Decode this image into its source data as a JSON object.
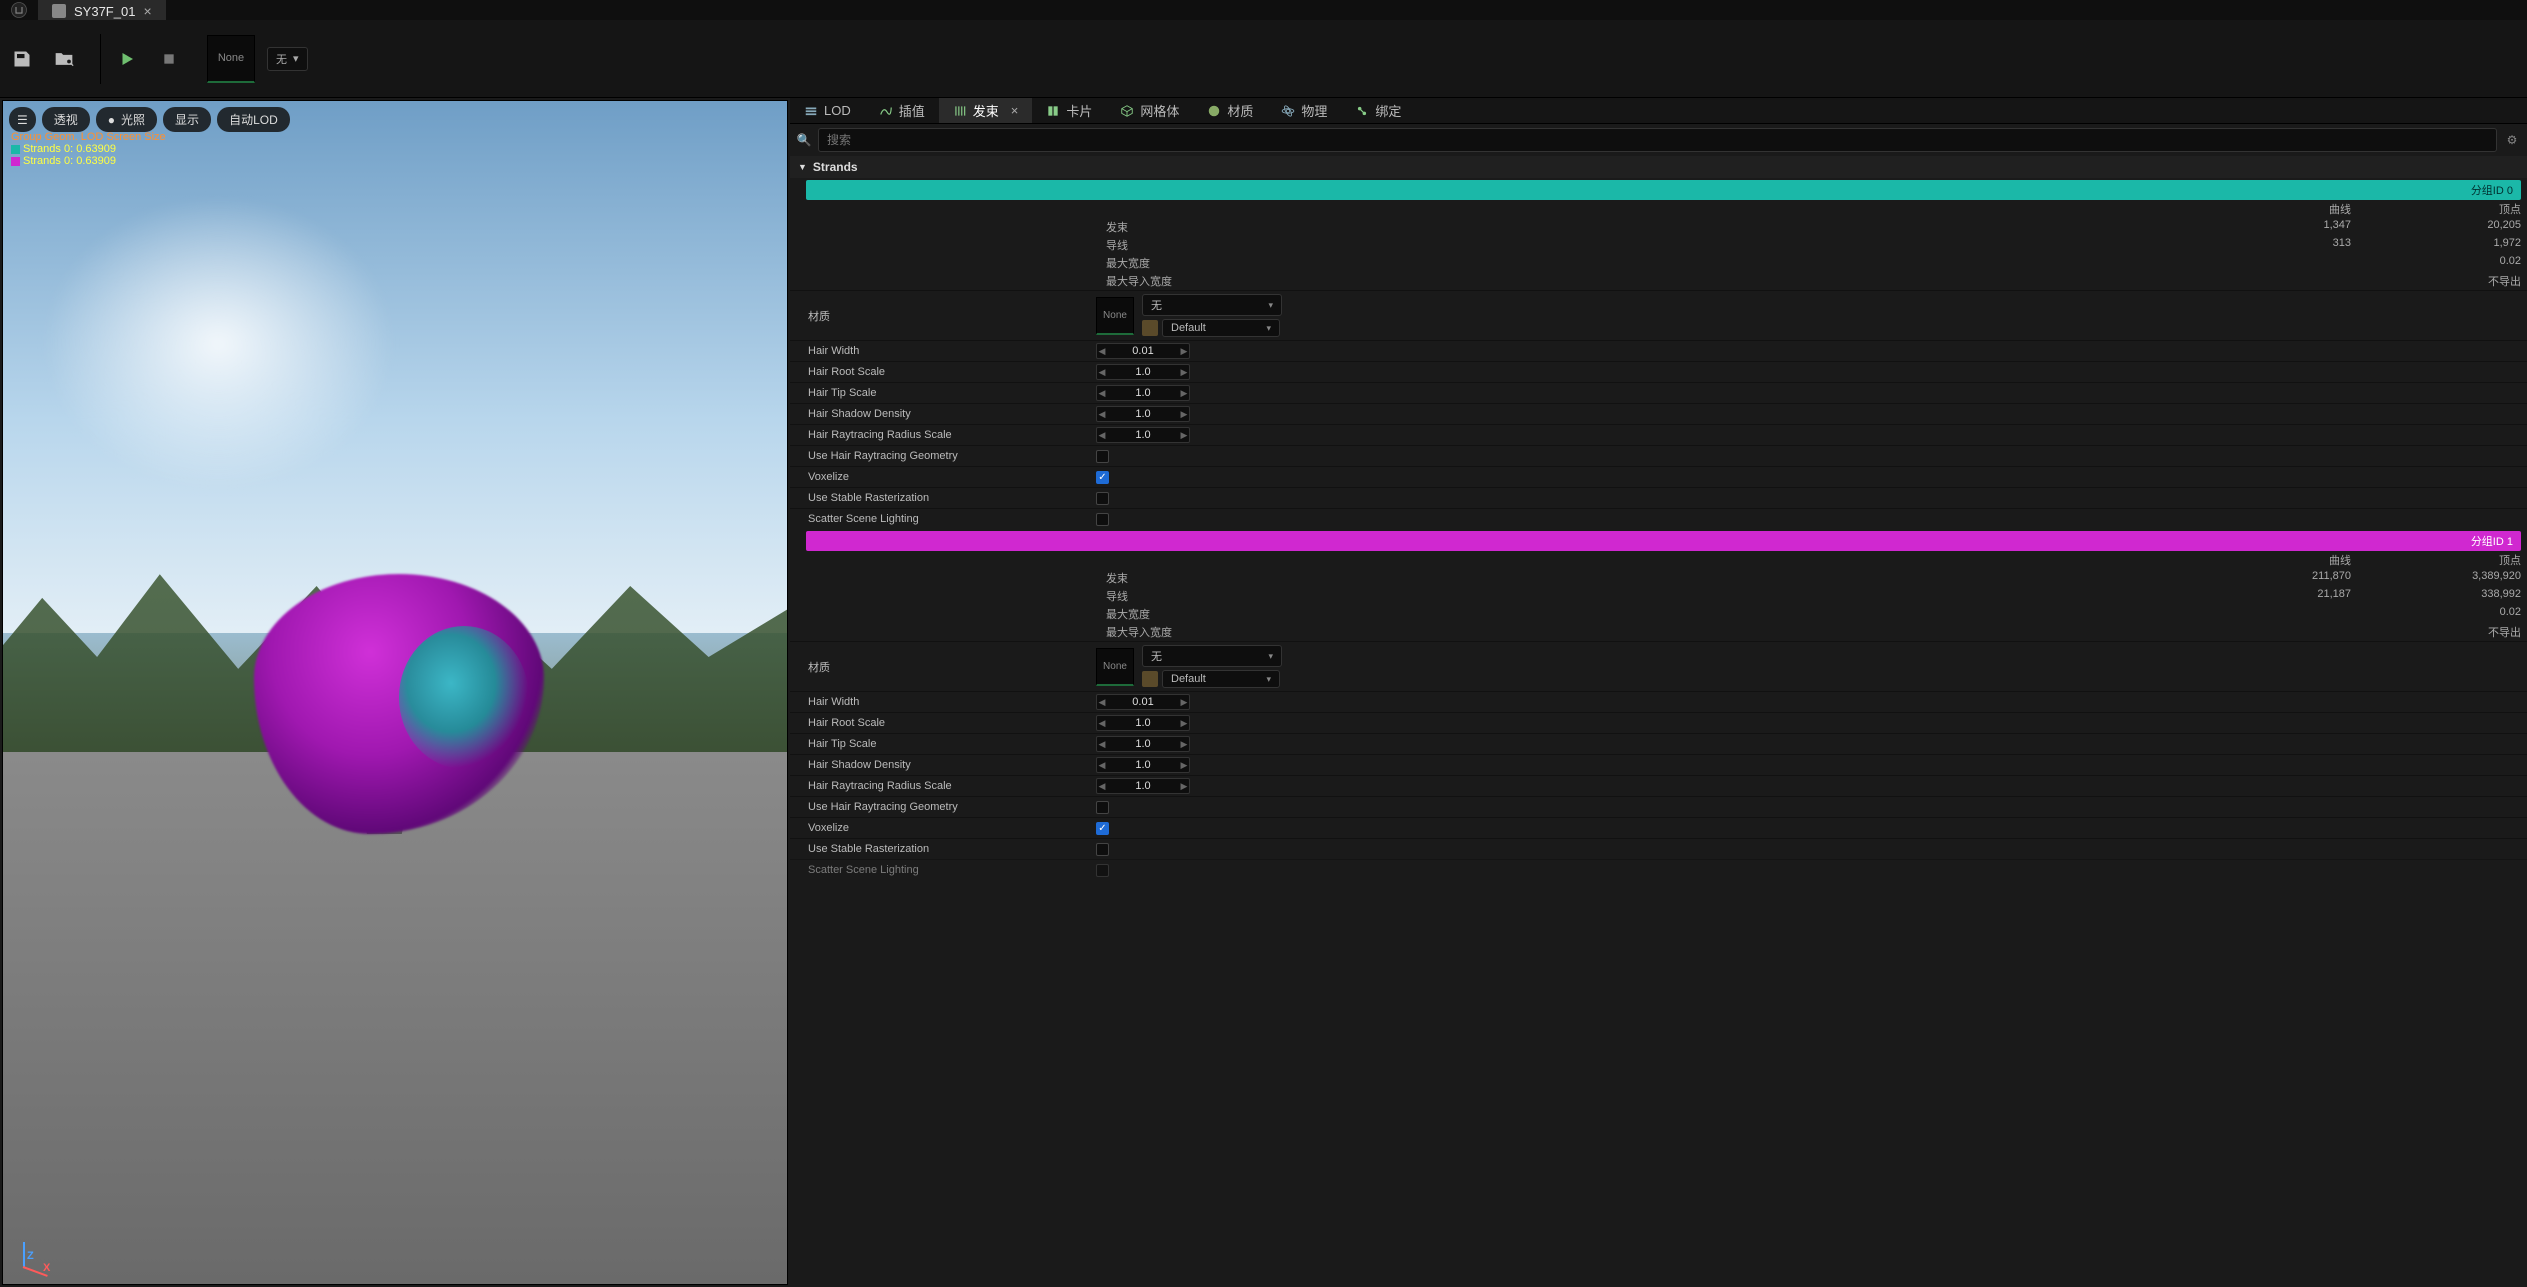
{
  "tab": {
    "title": "SY37F_01"
  },
  "toolbar": {
    "thumb_label": "None",
    "wu_label": "无"
  },
  "viewport": {
    "pills": {
      "perspective": "透视",
      "lighting": "光照",
      "display": "显示",
      "autolod": "自动LOD"
    },
    "stats": {
      "line1": "Group Geom. LOD  Screen Size",
      "line2a": "Strands 0:",
      "line2b": "0.63909",
      "line3a": "Strands 0:",
      "line3b": "0.63909"
    },
    "axis": {
      "z": "Z",
      "x": "X"
    }
  },
  "details_tabs": {
    "lod": "LOD",
    "interp": "插值",
    "strands": "发束",
    "cards": "卡片",
    "meshes": "网格体",
    "material": "材质",
    "physics": "物理",
    "binding": "绑定"
  },
  "search": {
    "placeholder": "搜索"
  },
  "category": {
    "strands": "Strands"
  },
  "group0": {
    "bar": "分组ID 0",
    "col_curves": "曲线",
    "col_verts": "顶点",
    "row_strands_l": "发束",
    "row_strands_c": "1,347",
    "row_strands_v": "20,205",
    "row_guides_l": "导线",
    "row_guides_c": "313",
    "row_guides_v": "1,972",
    "row_maxw_l": "最大宽度",
    "row_maxw_v": "0.02",
    "row_maximp_l": "最大导入宽度",
    "row_maximp_v": "不导出",
    "material_label": "材质",
    "mat_none": "None",
    "mat_dd1": "无",
    "mat_dd2": "Default"
  },
  "group1": {
    "bar": "分组ID 1",
    "col_curves": "曲线",
    "col_verts": "顶点",
    "row_strands_l": "发束",
    "row_strands_c": "211,870",
    "row_strands_v": "3,389,920",
    "row_guides_l": "导线",
    "row_guides_c": "21,187",
    "row_guides_v": "338,992",
    "row_maxw_l": "最大宽度",
    "row_maxw_v": "0.02",
    "row_maximp_l": "最大导入宽度",
    "row_maximp_v": "不导出",
    "material_label": "材质",
    "mat_none": "None",
    "mat_dd1": "无",
    "mat_dd2": "Default"
  },
  "props": {
    "hair_width": "Hair Width",
    "hair_root_scale": "Hair Root Scale",
    "hair_tip_scale": "Hair Tip Scale",
    "hair_shadow_density": "Hair Shadow Density",
    "hair_rt_radius_scale": "Hair Raytracing Radius Scale",
    "use_hair_rt_geom": "Use Hair Raytracing Geometry",
    "voxelize": "Voxelize",
    "use_stable_raster": "Use Stable Rasterization",
    "scatter_scene_lighting": "Scatter Scene Lighting"
  },
  "vals0": {
    "hair_width": "0.01",
    "hair_root_scale": "1.0",
    "hair_tip_scale": "1.0",
    "hair_shadow_density": "1.0",
    "hair_rt_radius_scale": "1.0"
  },
  "vals1": {
    "hair_width": "0.01",
    "hair_root_scale": "1.0",
    "hair_tip_scale": "1.0",
    "hair_shadow_density": "1.0",
    "hair_rt_radius_scale": "1.0"
  }
}
